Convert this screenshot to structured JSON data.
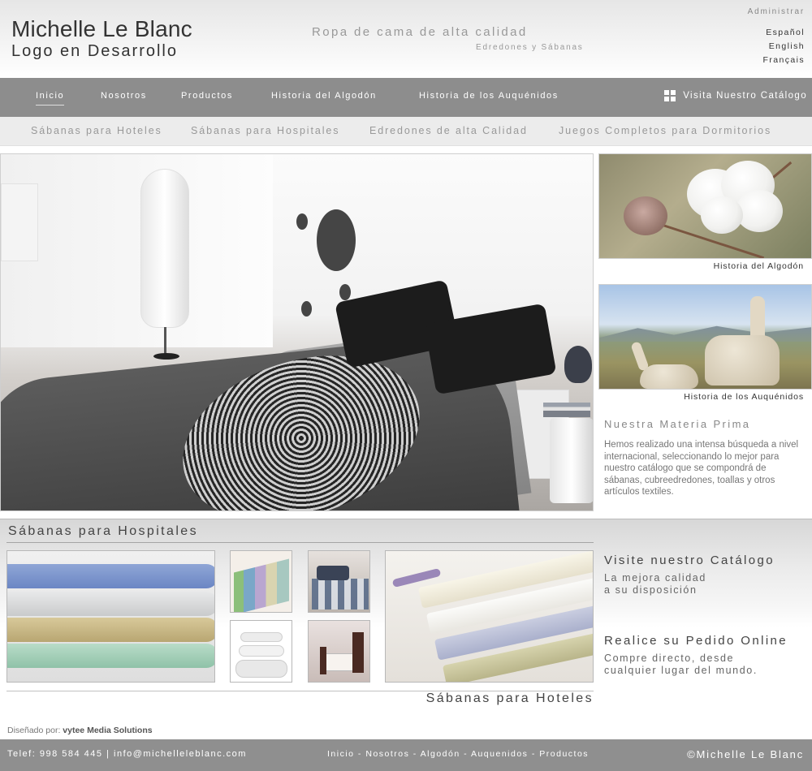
{
  "header": {
    "brand_name": "Michelle Le Blanc",
    "brand_logo": "Logo en Desarrollo",
    "tagline": "Ropa de cama de alta calidad",
    "subtagline": "Edredones y Sábanas",
    "admin_link": "Administrar",
    "languages": [
      "Español",
      "English",
      "Français"
    ]
  },
  "main_nav": {
    "items": [
      "Inicio",
      "Nosotros",
      "Productos",
      "Historia del Algodón",
      "Historia de los Auquénidos"
    ],
    "active": "Inicio",
    "catalog_link": "Visita Nuestro Catálogo",
    "catalog_icon": "grid-icon"
  },
  "sub_nav": {
    "items": [
      "Sábanas para Hoteles",
      "Sábanas para Hospitales",
      "Edredones de alta Calidad",
      "Juegos Completos para Dormitorios"
    ]
  },
  "sidebar": {
    "cotton_caption": "Historia del Algodón",
    "alpaca_caption": "Historia de los Auquénidos",
    "heading": "Nuestra Materia Prima",
    "text": "Hemos realizado una intensa búsqueda a nivel internacional, seleccionando lo mejor para nuestro catálogo que se compondrá de sábanas, cubreedredones, toallas y otros artículos textiles."
  },
  "products": {
    "top_title": "Sábanas para Hospitales",
    "bottom_title": "Sábanas para Hoteles",
    "promo1_title": "Visite nuestro Catálogo",
    "promo1_line1": "La mejora calidad",
    "promo1_line2": "a su disposición",
    "promo2_title": "Realice su Pedido Online",
    "promo2_line1": "Compre directo, desde",
    "promo2_line2": "cualquier lugar del mundo."
  },
  "credit": {
    "label": "Diseñado por:",
    "company": "vytee Media Solutions"
  },
  "footer": {
    "phone": "Telef: 998 584 445",
    "separator": "|",
    "email": "info@michelleleblanc.com",
    "links": [
      "Inicio",
      "Nosotros",
      "Algodón",
      "Auquenidos",
      "Productos"
    ],
    "link_separator": " - ",
    "copyright": "©Michelle Le Blanc"
  },
  "colors": {
    "nav_bg": "#8d8d8d",
    "subnav_bg": "#ececec",
    "footer_bg": "#8f8f8f",
    "text_dark": "#333333",
    "text_muted": "#999999"
  }
}
